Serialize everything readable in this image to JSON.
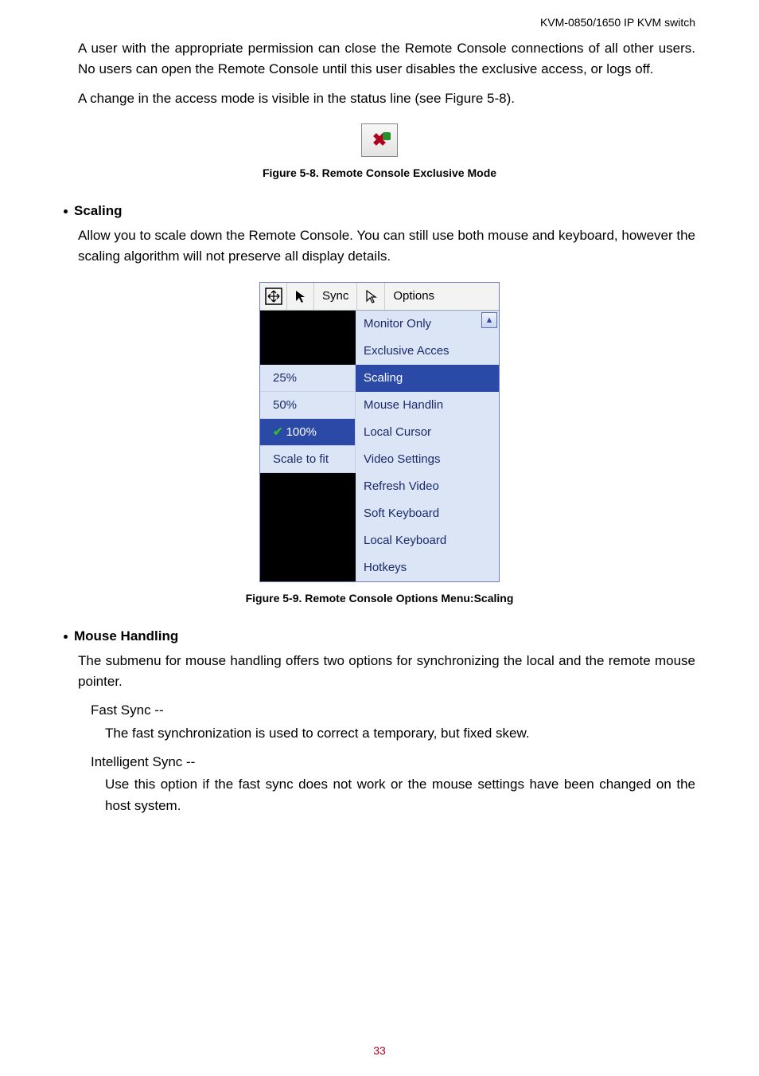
{
  "header": "KVM-0850/1650 IP KVM switch",
  "para1": "A user with the appropriate permission can close the Remote Console connections of all other users. No users can open the Remote Console until this user disables the exclusive access, or logs off.",
  "para2": "A change in the access mode is visible in the status line (see Figure 5-8).",
  "fig1_caption": "Figure 5-8. Remote Console Exclusive Mode",
  "scaling_heading": "Scaling",
  "scaling_para": "Allow you to scale down the Remote Console. You can still use both mouse and keyboard, however the scaling algorithm will not preserve all display details.",
  "toolbar": {
    "sync": "Sync",
    "options": "Options"
  },
  "scale_items": [
    "25%",
    "50%",
    "100%",
    "Scale to fit"
  ],
  "options_items": [
    "Monitor Only",
    "Exclusive Acces",
    "Scaling",
    "Mouse Handlin",
    "Local Cursor",
    "Video Settings",
    "Refresh Video",
    "Soft Keyboard",
    "Local Keyboard",
    "Hotkeys"
  ],
  "fig2_caption": "Figure 5-9. Remote Console Options Menu:Scaling",
  "mouse_heading": "Mouse Handling",
  "mouse_para": "The submenu for mouse handling offers two options for synchronizing the local and the remote mouse pointer.",
  "fast_sync_label": "Fast Sync --",
  "fast_sync_text": "The fast synchronization is used to correct a temporary, but fixed skew.",
  "intel_sync_label": "Intelligent Sync --",
  "intel_sync_text": "Use this option if the fast sync does not work or the mouse settings have been changed on the host system.",
  "page_num": "33"
}
